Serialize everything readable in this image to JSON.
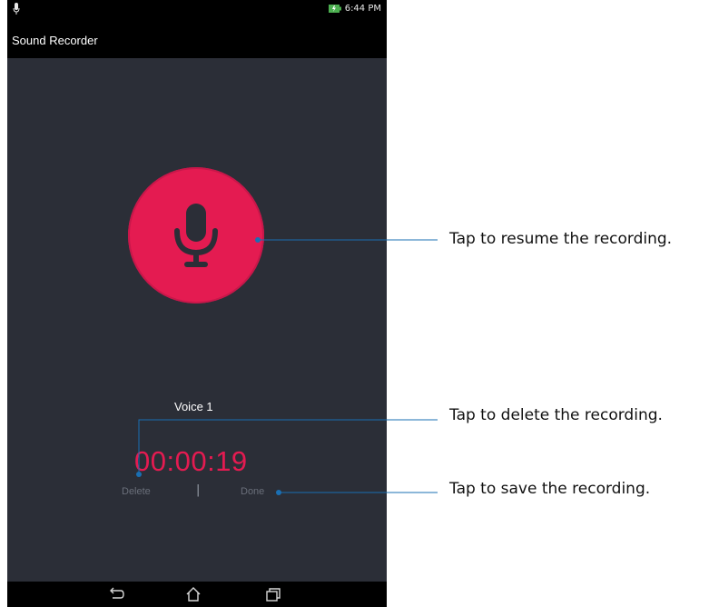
{
  "status_bar": {
    "time": "6:44 PM",
    "mic_icon": "mic-icon",
    "battery_icon": "battery-charging-icon",
    "battery_color": "#4caf50"
  },
  "app": {
    "title": "Sound Recorder"
  },
  "recorder": {
    "record_button_icon": "microphone-icon",
    "accent_color": "#e41b51",
    "voice_name": "Voice 1",
    "elapsed": "00:00:19",
    "delete_label": "Delete",
    "separator": "|",
    "done_label": "Done"
  },
  "nav_bar": {
    "back_icon": "back-icon",
    "home_icon": "home-icon",
    "recents_icon": "recents-icon"
  },
  "callouts": {
    "resume": "Tap to resume the recording.",
    "delete": "Tap to delete the recording.",
    "save": "Tap to save the recording.",
    "leader_color": "#1a6fb3"
  }
}
